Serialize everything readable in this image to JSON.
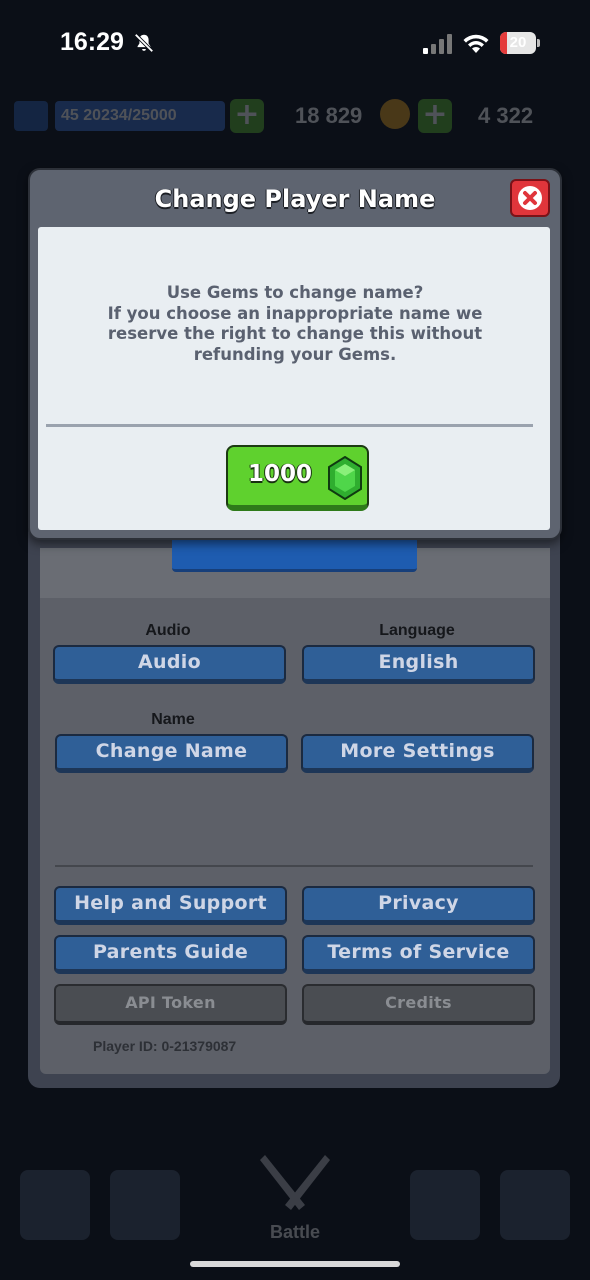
{
  "status_bar": {
    "time": "16:29",
    "battery_level": "20",
    "icons": [
      "bell-slash-icon",
      "cellular-signal-icon",
      "wifi-icon",
      "battery-icon"
    ]
  },
  "game_bar": {
    "level": "45",
    "xp": "20234/25000",
    "gold": "18 829",
    "gems": "4 322"
  },
  "modal": {
    "title": "Change Player Name",
    "message_line1": "Use Gems to change name?",
    "message_line2": "If you choose an inappropriate name we",
    "message_line3": "reserve the right to change this without",
    "message_line4": "refunding your Gems.",
    "cost": "1000",
    "cost_icon": "gem-icon",
    "close_icon": "close-icon"
  },
  "settings": {
    "audio_label": "Audio",
    "audio_button": "Audio",
    "language_label": "Language",
    "language_button": "English",
    "name_label": "Name",
    "change_name_button": "Change Name",
    "more_settings_button": "More Settings",
    "help_button": "Help and Support",
    "privacy_button": "Privacy",
    "parents_button": "Parents Guide",
    "terms_button": "Terms of Service",
    "api_button": "API Token",
    "credits_button": "Credits",
    "player_id": "Player ID: 0-21379087"
  },
  "bottom_nav": {
    "battle_label": "Battle"
  },
  "colors": {
    "modal_frame": "#5e6470",
    "modal_body": "#e9eef2",
    "gem_button": "#5fd12e",
    "close_button": "#e0353b",
    "settings_button": "#2f5f97"
  }
}
